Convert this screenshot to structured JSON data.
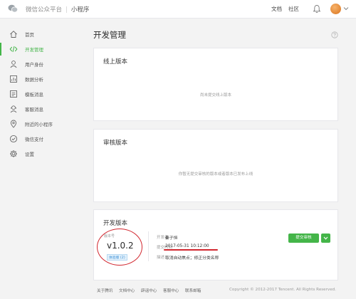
{
  "header": {
    "platform": "微信公众平台",
    "separator": "|",
    "app_name": "小程序",
    "nav_docs": "文档",
    "nav_community": "社区"
  },
  "sidebar": {
    "items": [
      {
        "label": "首页",
        "icon": "home-icon"
      },
      {
        "label": "开发管理",
        "icon": "code-icon",
        "active": true
      },
      {
        "label": "用户身份",
        "icon": "user-icon"
      },
      {
        "label": "数据分析",
        "icon": "chart-icon"
      },
      {
        "label": "模板消息",
        "icon": "template-icon"
      },
      {
        "label": "客服消息",
        "icon": "service-icon"
      },
      {
        "label": "附近的小程序",
        "icon": "location-icon"
      },
      {
        "label": "微信支付",
        "icon": "payment-icon"
      },
      {
        "label": "设置",
        "icon": "gear-icon"
      }
    ]
  },
  "main": {
    "title": "开发管理",
    "live": {
      "title": "线上版本",
      "empty": "尚未提交线上版本"
    },
    "review": {
      "title": "审核版本",
      "empty": "你暂无提交审核的版本或者版本已发布上线"
    },
    "dev": {
      "title": "开发版本",
      "version_label": "版本号",
      "version": "v1.0.2",
      "badge": "体验版 (2)",
      "developer_label": "开发者",
      "developer": "秦子恒",
      "submit_time_label": "提交时间",
      "submit_time": "2017-05-31 10:12:00",
      "desc_label": "描述",
      "desc": "取消自动焦点；修正分类名称",
      "submit_button": "提交审核"
    }
  },
  "footer": {
    "links": [
      "关于腾讯",
      "文档中心",
      "辟谣中心",
      "客服中心",
      "联系邮箱"
    ],
    "copyright": "Copyright © 2012-2017 Tencent. All Rights Reserved."
  },
  "colors": {
    "accent": "#44b549",
    "annotation": "#d2272f"
  }
}
